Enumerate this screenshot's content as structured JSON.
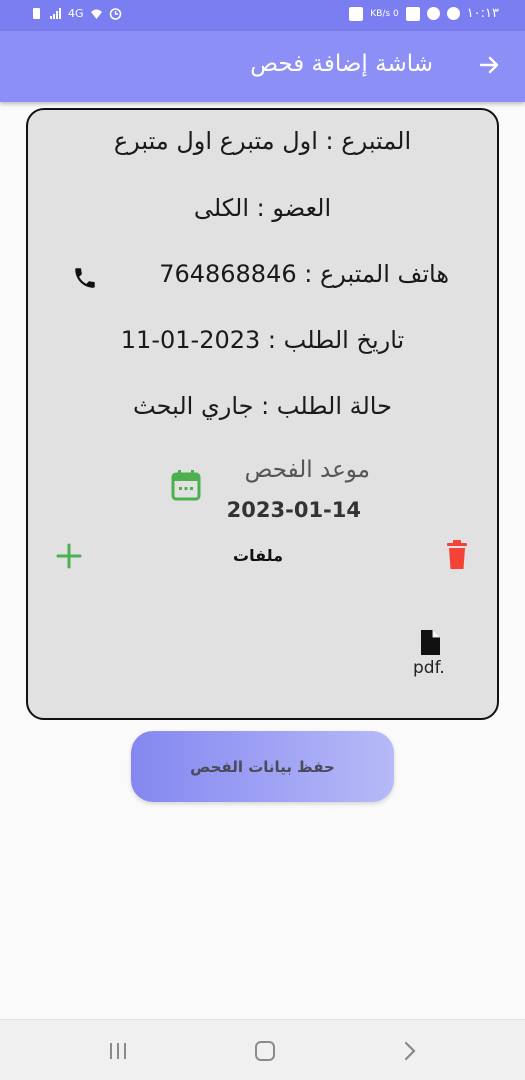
{
  "status_bar": {
    "time": "١٠:١٣",
    "network": "KB/s 0",
    "signal": "4G"
  },
  "app_bar": {
    "title": "شاشة إضافة فحص"
  },
  "card": {
    "donor_line": "المتبرع : اول متبرع  اول متبرع",
    "organ_line": "العضو : الكلى",
    "phone_line": "هاتف المتبرع : 764868846",
    "request_date_line": "تاريخ الطلب :  2023-01-11",
    "request_status_line": "حالة الطلب : جاري البحث",
    "exam_appointment_label": "موعد الفحص",
    "exam_appointment_date": "2023-01-14",
    "files_label": "ملفات",
    "file_ext": "pdf."
  },
  "save_button_label": "حفظ بيانات الفحص",
  "colors": {
    "primary": "#8c8ff5",
    "status_bar": "#7b7ef0",
    "card_bg": "#e1e1e1",
    "add_green": "#4caf50",
    "trash_red": "#f44336"
  }
}
